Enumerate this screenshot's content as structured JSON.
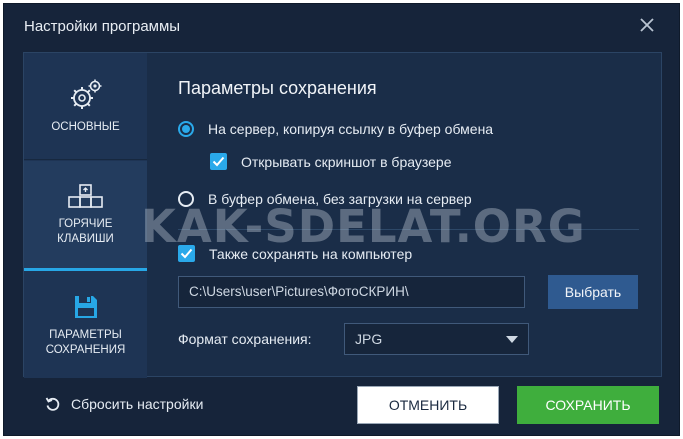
{
  "window": {
    "title": "Настройки программы"
  },
  "sidebar": {
    "items": [
      {
        "label": "ОСНОВНЫЕ",
        "icon": "gears-icon",
        "active": false
      },
      {
        "label": "ГОРЯЧИЕ\nКЛАВИШИ",
        "icon": "keyboard-keys-icon",
        "active": true
      },
      {
        "label": "ПАРАМЕТРЫ\nСОХРАНЕНИЯ",
        "icon": "floppy-disk-icon",
        "active": false
      }
    ]
  },
  "main": {
    "heading": "Параметры сохранения",
    "radio_server": {
      "label": "На сервер, копируя ссылку в буфер обмена",
      "checked": true
    },
    "check_browser": {
      "label": "Открывать скриншот в браузере",
      "checked": true
    },
    "radio_clipboard": {
      "label": "В буфер обмена, без загрузки на сервер",
      "checked": false
    },
    "check_save_local": {
      "label": "Также сохранять на компьютер",
      "checked": true
    },
    "path": {
      "value": "C:\\Users\\user\\Pictures\\ФотоСКРИН\\"
    },
    "browse_label": "Выбрать",
    "format": {
      "label": "Формат сохранения:",
      "value": "JPG"
    }
  },
  "footer": {
    "reset_label": "Сбросить настройки",
    "cancel_label": "ОТМЕНИТЬ",
    "save_label": "СОХРАНИТЬ"
  },
  "watermark": "KAK-SDELAT.ORG",
  "colors": {
    "accent": "#2aa9ea",
    "save": "#3fae3d",
    "background": "#16243a"
  }
}
